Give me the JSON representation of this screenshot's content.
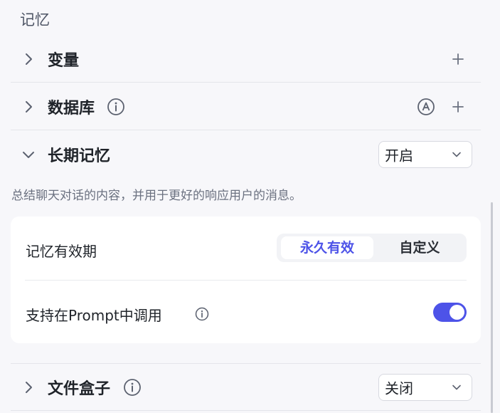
{
  "section": {
    "title": "记忆"
  },
  "rows": {
    "variables": {
      "label": "变量"
    },
    "database": {
      "label": "数据库"
    },
    "long_memory": {
      "label": "长期记忆",
      "select_value": "开启"
    },
    "file_box": {
      "label": "文件盒子",
      "select_value": "关闭"
    }
  },
  "long_memory_desc": "总结聊天对话的内容，并用于更好的响应用户的消息。",
  "card": {
    "validity_label": "记忆有效期",
    "validity_options": [
      "永久有效",
      "自定义"
    ],
    "validity_selected": "永久有效",
    "prompt_label": "支持在Prompt中调用",
    "prompt_toggle_on": true
  },
  "colors": {
    "accent": "#4d53e8"
  },
  "icons": {
    "expand": "chevron-right-icon",
    "collapse": "chevron-down-icon",
    "info": "info-icon",
    "add": "plus-icon",
    "auto": "auto-a-icon"
  }
}
